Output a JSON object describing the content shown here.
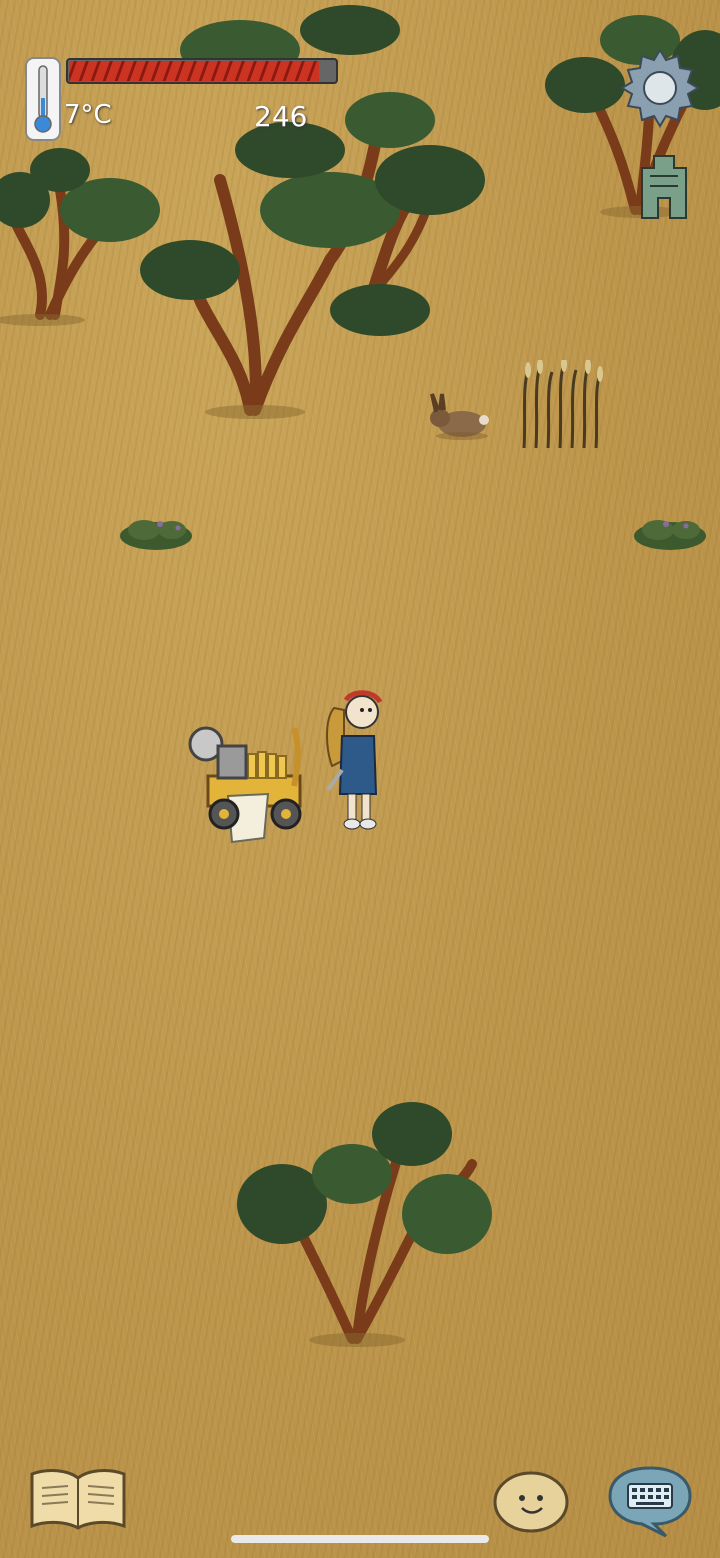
{
  "hud": {
    "temperature": "7°C",
    "score": "246",
    "health_fraction": 0.94,
    "health_color": "#d32f2f",
    "icons": {
      "thermometer": "thermometer-icon",
      "settings": "gear-icon",
      "totem": "totem-icon",
      "journal": "open-book-icon",
      "companion": "potato-face-icon",
      "chat": "keyboard-chat-icon"
    }
  }
}
